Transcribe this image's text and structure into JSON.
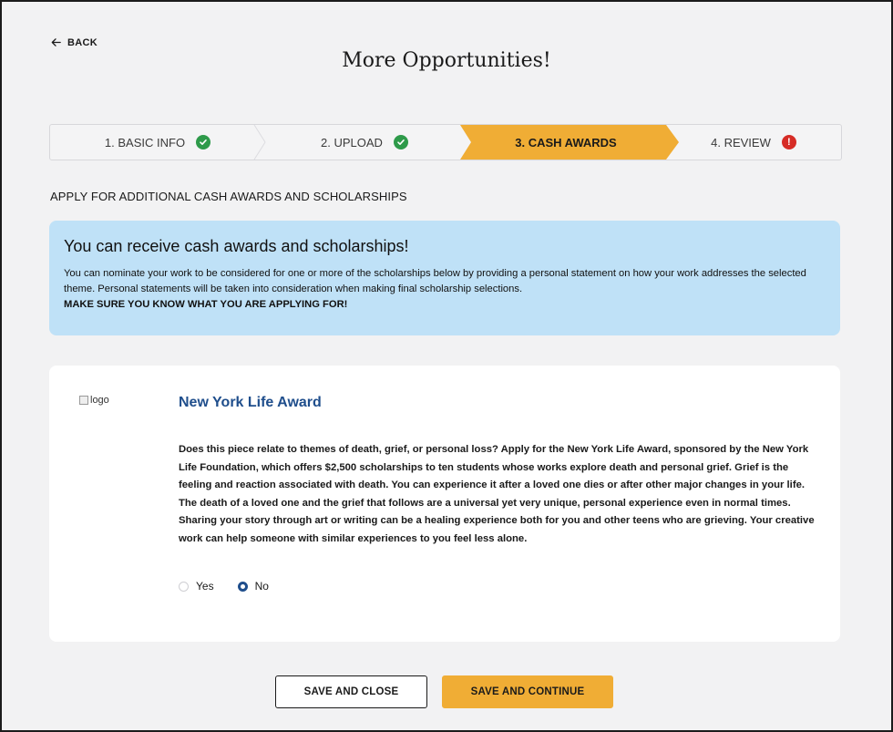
{
  "header": {
    "back_label": "BACK",
    "title": "More Opportunities!"
  },
  "stepper": {
    "steps": [
      {
        "label": "1. BASIC INFO",
        "status": "complete"
      },
      {
        "label": "2. UPLOAD",
        "status": "complete"
      },
      {
        "label": "3. CASH AWARDS",
        "status": "active"
      },
      {
        "label": "4. REVIEW",
        "status": "error"
      }
    ],
    "active_color": "#f0ad35",
    "complete_color": "#2e9a4a",
    "error_color": "#d62c26"
  },
  "section_heading": "APPLY FOR ADDITIONAL CASH AWARDS AND SCHOLARSHIPS",
  "info_box": {
    "title": "You can receive cash awards and scholarships!",
    "text": "You can nominate your work to be considered for one or more of the scholarships below by providing a personal statement on how your work addresses the selected theme. Personal statements will be taken into consideration when making final scholarship selections.",
    "strong": "MAKE SURE YOU KNOW WHAT YOU ARE APPLYING FOR!",
    "background": "#bfe1f7"
  },
  "award": {
    "logo_alt": "logo",
    "title": "New York Life Award",
    "description": "Does this piece relate to themes of death, grief, or personal loss?  Apply for the New York Life Award, sponsored by the New York Life Foundation, which offers $2,500 scholarships to ten students whose works explore death and personal grief. Grief is the feeling and reaction associated with death. You can experience it after a loved one dies or after other major changes in your life. The death of a loved one and the grief that follows are a universal yet very unique, personal experience even in normal times. Sharing your story through art or writing can be a healing experience both for you and other teens who are grieving. Your creative work can help someone with similar experiences to you feel less alone.",
    "options": [
      "Yes",
      "No"
    ],
    "selected": "No"
  },
  "footer": {
    "save_close_label": "SAVE AND CLOSE",
    "save_continue_label": "SAVE AND CONTINUE"
  }
}
